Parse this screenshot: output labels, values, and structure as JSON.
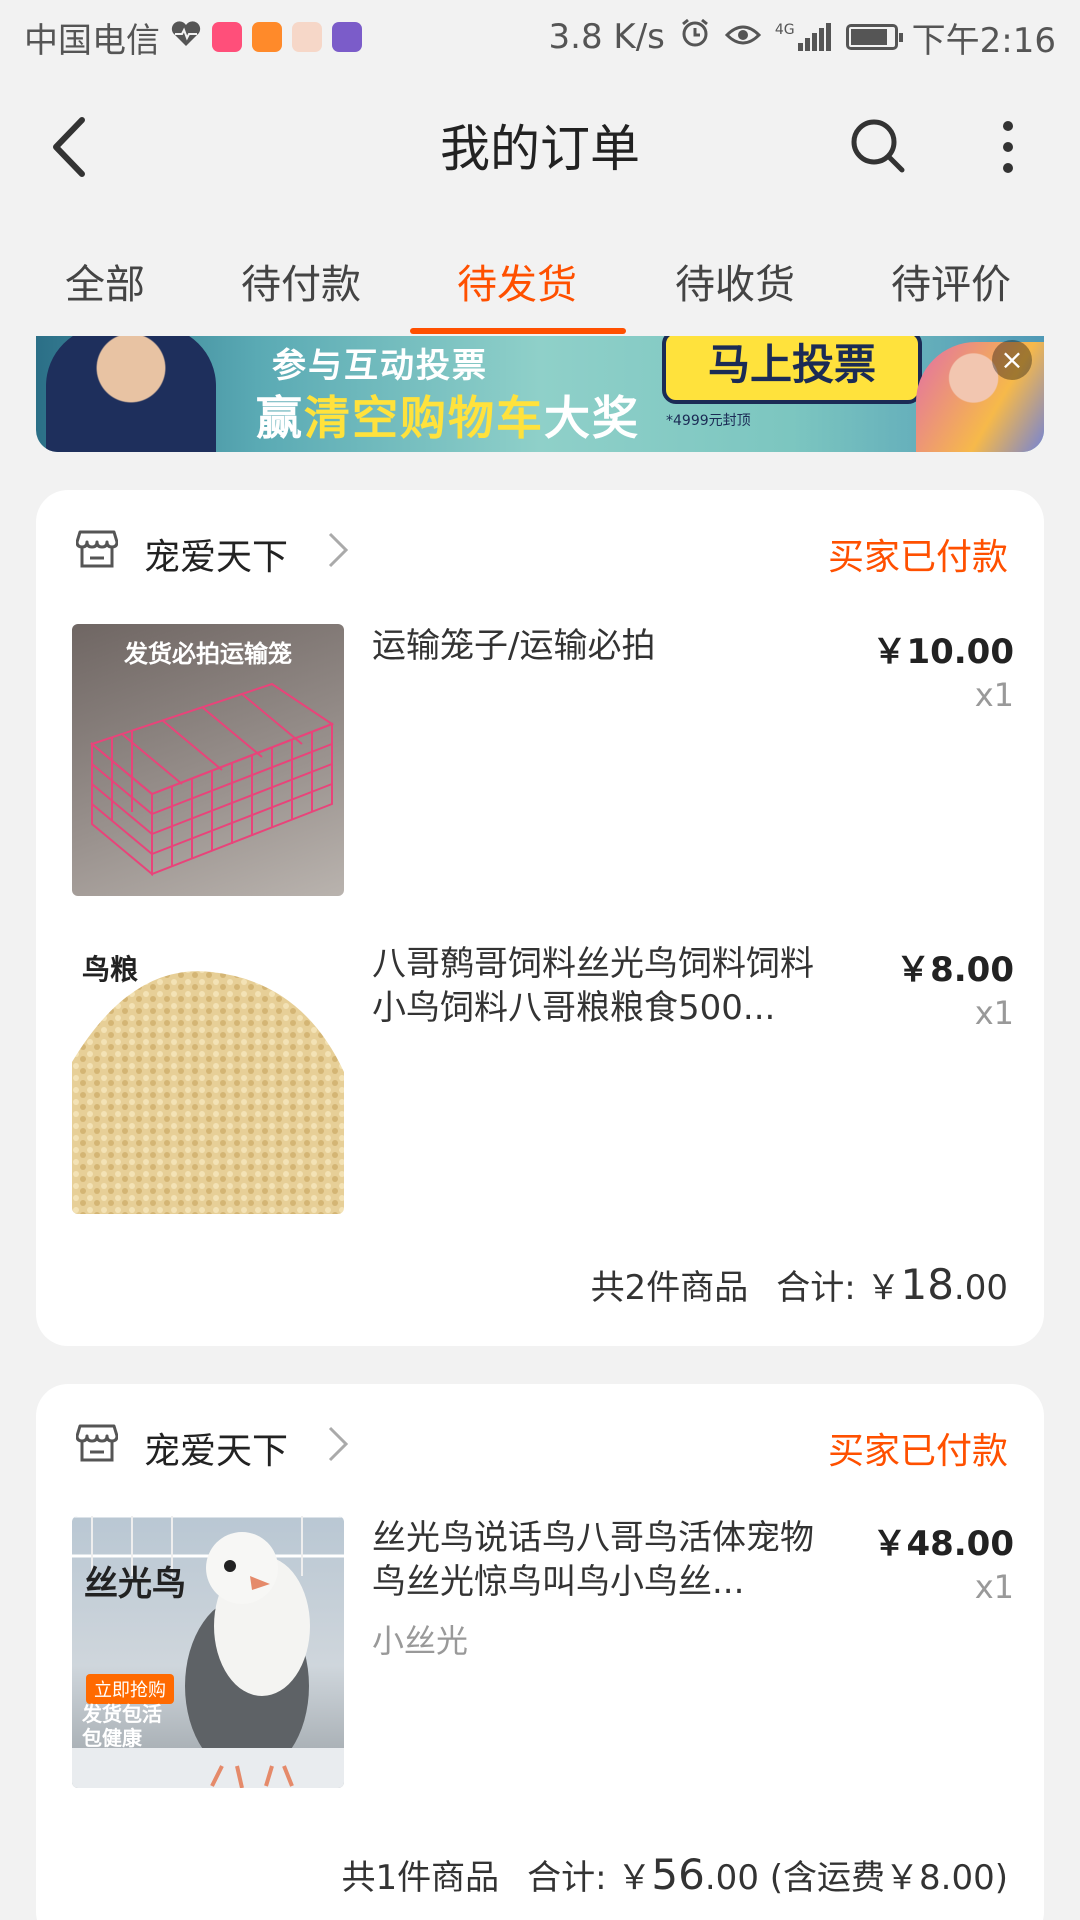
{
  "status_bar": {
    "carrier": "中国电信",
    "speed": "3.8 K/s",
    "network": "4G",
    "time": "下午2:16",
    "battery_level": 0.85
  },
  "header": {
    "title": "我的订单",
    "back_icon": "back-arrow-icon",
    "search_icon": "search-icon",
    "more_icon": "more-vertical-icon"
  },
  "tabs": [
    {
      "label": "全部"
    },
    {
      "label": "待付款"
    },
    {
      "label": "待发货"
    },
    {
      "label": "待收货"
    },
    {
      "label": "待评价"
    }
  ],
  "active_tab_index": 2,
  "banner": {
    "line1": "参与互动投票",
    "line2_prefix": "赢",
    "line2_highlight": "清空购物车",
    "line2_suffix": "大奖",
    "button": "马上投票",
    "note": "*4999元封顶",
    "close": "×"
  },
  "orders": [
    {
      "shop": "宠爱天下",
      "status": "买家已付款",
      "items": [
        {
          "image_caption": "发货必拍运输笼",
          "name": "运输笼子/运输必拍",
          "sku": "",
          "price": "￥10.00",
          "qty": "x1"
        },
        {
          "image_caption": "鸟粮",
          "name": "八哥鹩哥饲料丝光鸟饲料饲料小鸟饲料八哥粮粮食500...",
          "sku": "",
          "price": "￥8.00",
          "qty": "x1"
        }
      ],
      "summary": {
        "count": "共2件商品",
        "total_label": "合计: ￥",
        "total_int": "18",
        "total_dec": ".00",
        "shipping": ""
      }
    },
    {
      "shop": "宠爱天下",
      "status": "买家已付款",
      "items": [
        {
          "image_caption": "丝光鸟",
          "image_badge": "立即抢购",
          "image_note": "发货包活 包健康",
          "name": "丝光鸟说话鸟八哥鸟活体宠物鸟丝光惊鸟叫鸟小鸟丝...",
          "sku": "小丝光",
          "price": "￥48.00",
          "qty": "x1"
        }
      ],
      "summary": {
        "count": "共1件商品",
        "total_label": "合计: ￥",
        "total_int": "56",
        "total_dec": ".00",
        "shipping": "(含运费￥8.00)"
      }
    }
  ],
  "colors": {
    "accent": "#ff5000",
    "background": "#f2f2f2",
    "card": "#ffffff"
  }
}
